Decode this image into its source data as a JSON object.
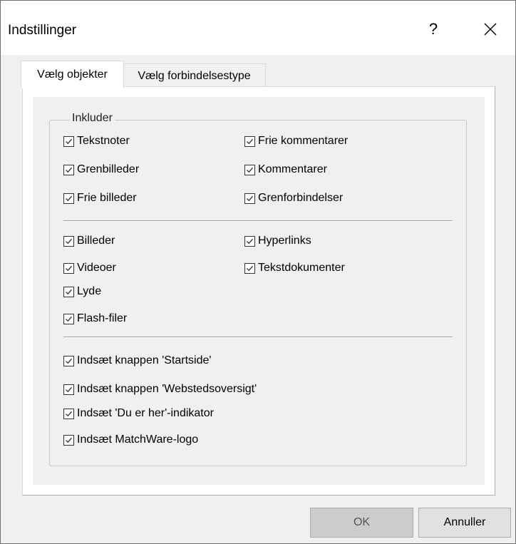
{
  "dialog": {
    "title": "Indstillinger",
    "help_label": "?",
    "close_label": "×"
  },
  "tabs": [
    {
      "label": "Vælg objekter",
      "active": true
    },
    {
      "label": "Vælg forbindelsestype",
      "active": false
    }
  ],
  "group": {
    "legend": "Inkluder",
    "section1": {
      "left": [
        {
          "label": "Tekstnoter",
          "checked": true
        },
        {
          "label": "Grenbilleder",
          "checked": true
        },
        {
          "label": "Frie billeder",
          "checked": true
        }
      ],
      "right": [
        {
          "label": "Frie kommentarer",
          "checked": true
        },
        {
          "label": "Kommentarer",
          "checked": true
        },
        {
          "label": "Grenforbindelser",
          "checked": true
        }
      ]
    },
    "section2": {
      "left": [
        {
          "label": "Billeder",
          "checked": true
        },
        {
          "label": "Videoer",
          "checked": true
        },
        {
          "label": "Lyde",
          "checked": true
        },
        {
          "label": "Flash-filer",
          "checked": true
        }
      ],
      "right": [
        {
          "label": "Hyperlinks",
          "checked": true
        },
        {
          "label": "Tekstdokumenter",
          "checked": true
        }
      ]
    },
    "section3": [
      {
        "label": "Indsæt knappen 'Startside'",
        "checked": true
      },
      {
        "label": "Indsæt knappen 'Webstedsoversigt'",
        "checked": true
      },
      {
        "label": "Indsæt 'Du er her'-indikator",
        "checked": true
      },
      {
        "label": "Indsæt MatchWare-logo",
        "checked": true
      }
    ]
  },
  "buttons": {
    "ok": "OK",
    "cancel": "Annuller"
  }
}
